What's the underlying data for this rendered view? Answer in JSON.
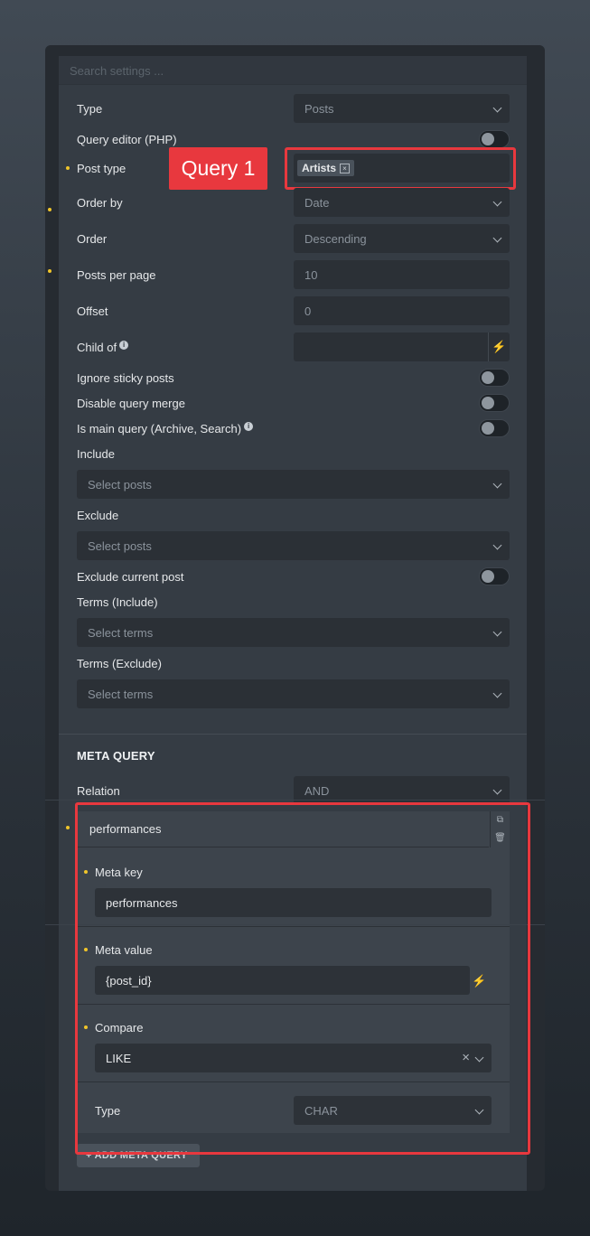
{
  "search": {
    "placeholder": "Search settings ..."
  },
  "fields": {
    "type": {
      "label": "Type",
      "value": "Posts"
    },
    "query_editor": {
      "label": "Query editor (PHP)"
    },
    "post_type": {
      "label": "Post type",
      "chip": "Artists",
      "chip_remove": "×"
    },
    "order_by": {
      "label": "Order by",
      "value": "Date"
    },
    "order": {
      "label": "Order",
      "value": "Descending"
    },
    "posts_per_page": {
      "label": "Posts per page",
      "value": "10"
    },
    "offset": {
      "label": "Offset",
      "value": "0"
    },
    "child_of": {
      "label": "Child of"
    },
    "ignore_sticky": {
      "label": "Ignore sticky posts"
    },
    "disable_merge": {
      "label": "Disable query merge"
    },
    "is_main_query": {
      "label": "Is main query (Archive, Search)"
    },
    "include": {
      "label": "Include",
      "placeholder": "Select posts"
    },
    "exclude": {
      "label": "Exclude",
      "placeholder": "Select posts"
    },
    "exclude_current": {
      "label": "Exclude current post"
    },
    "terms_include": {
      "label": "Terms (Include)",
      "placeholder": "Select terms"
    },
    "terms_exclude": {
      "label": "Terms (Exclude)",
      "placeholder": "Select terms"
    }
  },
  "meta_query": {
    "heading": "META QUERY",
    "relation": {
      "label": "Relation",
      "value": "AND"
    },
    "item": {
      "title": "performances",
      "meta_key": {
        "label": "Meta key",
        "value": "performances"
      },
      "meta_value": {
        "label": "Meta value",
        "value": "{post_id}"
      },
      "compare": {
        "label": "Compare",
        "value": "LIKE",
        "clear": "×"
      },
      "type": {
        "label": "Type",
        "value": "CHAR"
      }
    },
    "add_button": "+ ADD META QUERY"
  },
  "annotation": {
    "label": "Query 1"
  },
  "icons": {
    "info": "i",
    "bolt": "⚡",
    "copy": "⧉",
    "trash": "🗑"
  },
  "colors": {
    "highlight": "#e8383e",
    "dot": "#f0c52a",
    "panel": "#353c44"
  }
}
